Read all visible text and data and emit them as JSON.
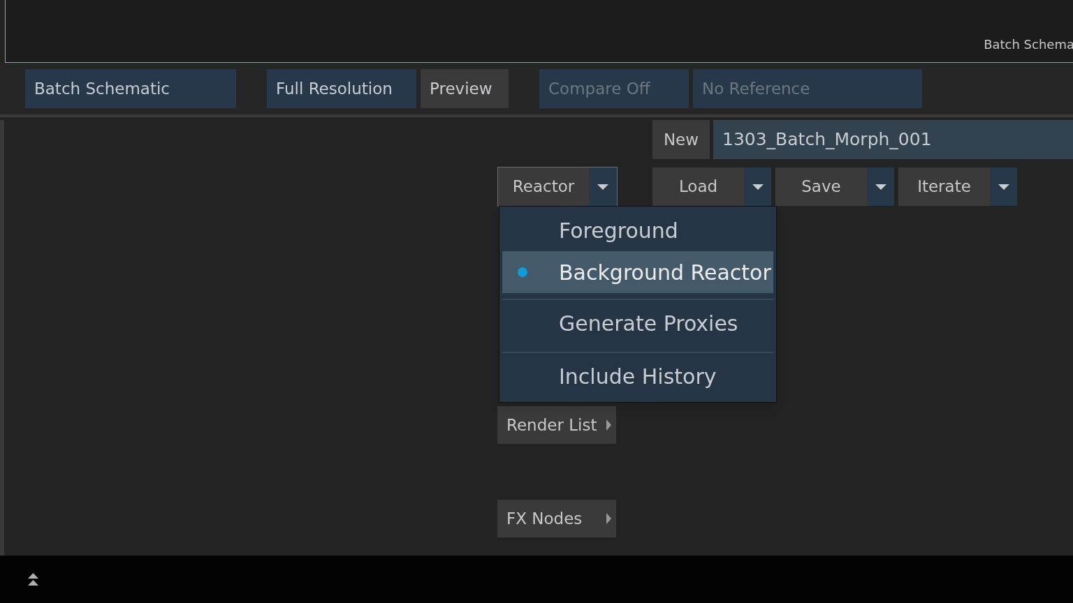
{
  "header": {
    "title": "Batch Schema"
  },
  "toolbar": [
    {
      "label": "Batch Schematic",
      "kind": "field",
      "disabled": false
    },
    {
      "label": "Full Resolution",
      "kind": "field",
      "disabled": false
    },
    {
      "label": "Preview",
      "kind": "button",
      "disabled": false
    },
    {
      "label": "Compare Off",
      "kind": "field",
      "disabled": true
    },
    {
      "label": "No Reference",
      "kind": "field",
      "disabled": true
    }
  ],
  "setup": {
    "new_button": "New",
    "name_field": "1303_Batch_Morph_001",
    "actions": [
      {
        "label": "Load"
      },
      {
        "label": "Save"
      },
      {
        "label": "Iterate"
      }
    ]
  },
  "reactor": {
    "label": "Reactor",
    "expanded": true,
    "menu": [
      {
        "label": "Foreground",
        "kind": "radio",
        "selected": false,
        "divider_before": false
      },
      {
        "label": "Background Reactor",
        "kind": "radio",
        "selected": true,
        "divider_before": false
      },
      {
        "label": "Generate Proxies",
        "kind": "option",
        "selected": false,
        "divider_before": true
      },
      {
        "label": "Include History",
        "kind": "option",
        "selected": false,
        "divider_before": true
      }
    ]
  },
  "submenus": [
    {
      "label": "Render List"
    },
    {
      "label": "FX Nodes"
    }
  ]
}
